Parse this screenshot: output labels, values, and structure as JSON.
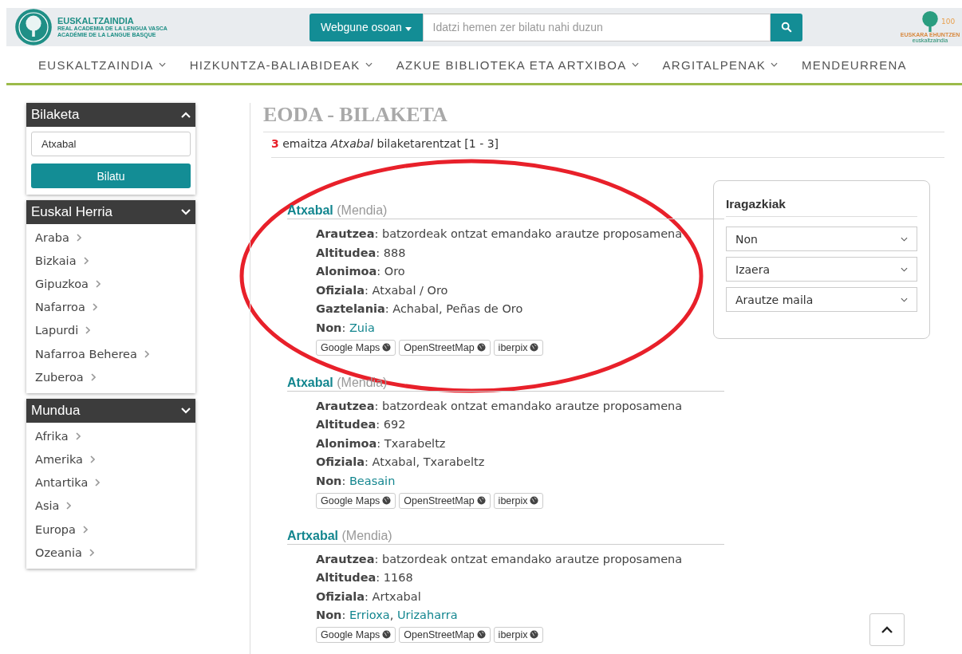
{
  "header": {
    "logo": {
      "name": "EUSKALTZAINDIA",
      "lines": [
        "REAL ACADEMIA DE LA LENGUA VASCA",
        "ACADÉMIE DE LA LANGUE BASQUE"
      ]
    },
    "scope_button": "Webgune osoan",
    "search": {
      "placeholder": "Idatzi hemen zer bilatu nahi duzun"
    },
    "badge": {
      "number": "100",
      "title": "EUSKARA EHUNTZEN",
      "subtitle": "euskaltzaindia"
    }
  },
  "nav": [
    "EUSKALTZAINDIA",
    "HIZKUNTZA-BALIABIDEAK",
    "AZKUE BIBLIOTEKA ETA ARTXIBOA",
    "ARGITALPENAK",
    "MENDEURRENA"
  ],
  "nav_dropdown": [
    true,
    true,
    true,
    true,
    false
  ],
  "sidebar": [
    {
      "title": "Bilaketa",
      "expanded": true,
      "kind": "search",
      "value": "Atxabal",
      "button": "Bilatu"
    },
    {
      "title": "Euskal Herria",
      "expanded": false,
      "kind": "list",
      "items": [
        "Araba",
        "Bizkaia",
        "Gipuzkoa",
        "Nafarroa",
        "Lapurdi",
        "Nafarroa Beherea",
        "Zuberoa"
      ]
    },
    {
      "title": "Mundua",
      "expanded": false,
      "kind": "list",
      "items": [
        "Afrika",
        "Amerika",
        "Antartika",
        "Asia",
        "Europa",
        "Ozeania"
      ]
    }
  ],
  "page_title": "EODA - BILAKETA",
  "summary": {
    "count": "3",
    "text": "emaitza *Atxabal* bilaketarentzat [1 - 3]"
  },
  "results": [
    {
      "name": "Atxabal",
      "type": "(Mendia)",
      "fields": [
        "**Arautzea**: batzordeak ontzat emandako arautze proposamena",
        "**Altitudea**: 888",
        "**Alonimoa**: Oro",
        "**Ofiziala**: Atxabal / Oro",
        "**Gaztelania**: Achabal, Peñas de Oro"
      ],
      "place_label": "**Non**:",
      "places": [
        "Zuia"
      ],
      "maps": [
        "Google Maps",
        "OpenStreetMap",
        "iberpix"
      ]
    },
    {
      "name": "Atxabal",
      "type": "(Mendia)",
      "fields": [
        "**Arautzea**: batzordeak ontzat emandako arautze proposamena",
        "**Altitudea**: 692",
        "**Alonimoa**: Txarabeltz",
        "**Ofiziala**: Atxabal, Txarabeltz"
      ],
      "place_label": "**Non**:",
      "places": [
        "Beasain"
      ],
      "maps": [
        "Google Maps",
        "OpenStreetMap",
        "iberpix"
      ]
    },
    {
      "name": "Artxabal",
      "type": "(Mendia)",
      "fields": [
        "**Arautzea**: batzordeak ontzat emandako arautze proposamena",
        "**Altitudea**: 1168",
        "**Ofiziala**: Artxabal"
      ],
      "place_label": "**Non**:",
      "places": [
        "Errioxa",
        "Urizaharra"
      ],
      "separator": ",",
      "maps": [
        "Google Maps",
        "OpenStreetMap",
        "iberpix"
      ]
    }
  ],
  "filters": {
    "title": "Iragazkiak",
    "selects": [
      "Non",
      "Izaera",
      "Arautze maila"
    ]
  },
  "annotation": {
    "kind": "ellipse"
  }
}
